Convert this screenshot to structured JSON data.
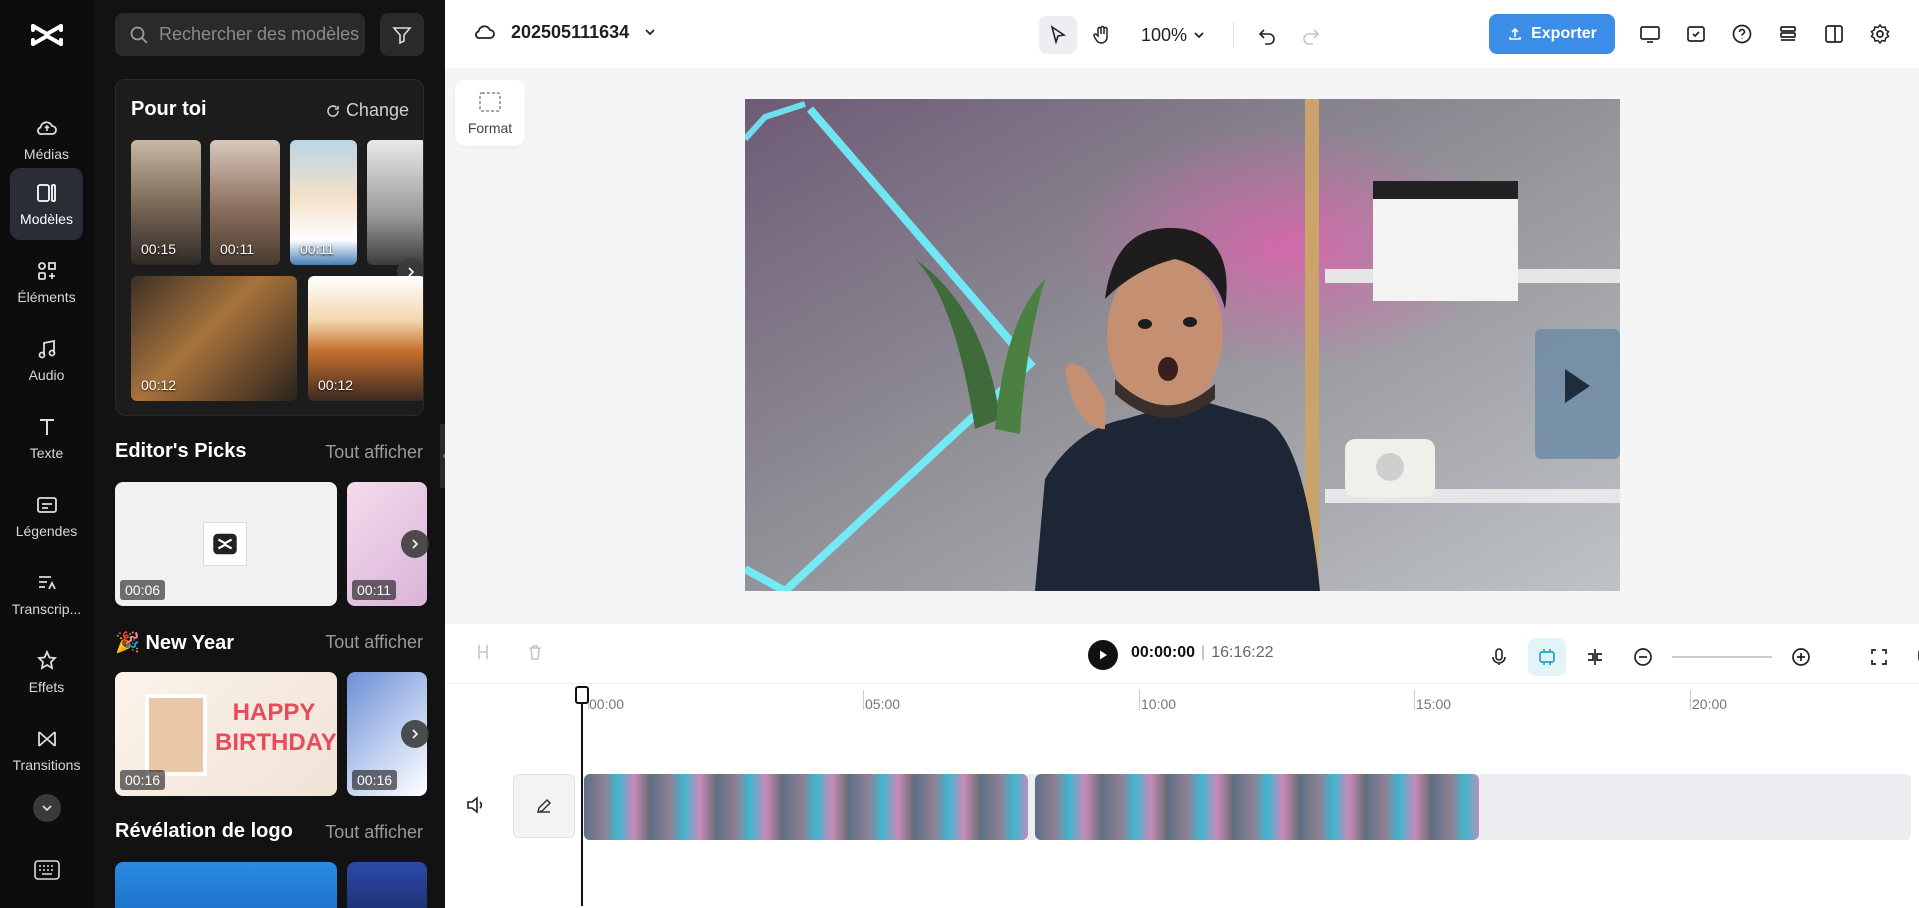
{
  "app": {
    "brand": "CapCut",
    "accent": "#3b8de8"
  },
  "rail": {
    "items": [
      {
        "label": "Médias",
        "icon": "cloud-icon"
      },
      {
        "label": "Modèles",
        "icon": "templates-icon",
        "active": true
      },
      {
        "label": "Éléments",
        "icon": "elements-icon"
      },
      {
        "label": "Audio",
        "icon": "music-icon"
      },
      {
        "label": "Texte",
        "icon": "text-icon"
      },
      {
        "label": "Légendes",
        "icon": "captions-icon"
      },
      {
        "label": "Transcrip...",
        "icon": "transcript-icon"
      },
      {
        "label": "Effets",
        "icon": "effects-icon"
      },
      {
        "label": "Transitions",
        "icon": "transitions-icon"
      }
    ]
  },
  "panel": {
    "search_placeholder": "Rechercher des modèles",
    "foryou": {
      "title": "Pour toi",
      "change_label": "Change",
      "thumbs": [
        "00:15",
        "00:11",
        "00:11",
        "00:12",
        "00:12"
      ]
    },
    "sections": [
      {
        "title": "Editor's Picks",
        "all_label": "Tout afficher",
        "cards": [
          "00:06",
          "00:11"
        ]
      },
      {
        "title": "🎉 New Year",
        "all_label": "Tout afficher",
        "cards": [
          "00:16",
          "00:16"
        ]
      },
      {
        "title": "Révélation de logo",
        "all_label": "Tout afficher",
        "cards": []
      }
    ],
    "birthday_text": "HAPPY BIRTHDAY"
  },
  "topbar": {
    "project_name": "202505111634",
    "zoom": "100%",
    "export_label": "Exporter"
  },
  "stage": {
    "format_label": "Format"
  },
  "player": {
    "current": "00:00:00",
    "separator": "|",
    "total": "16:16:22"
  },
  "timeline": {
    "ruler": [
      "00:00",
      "05:00",
      "10:00",
      "15:00",
      "20:00"
    ]
  }
}
